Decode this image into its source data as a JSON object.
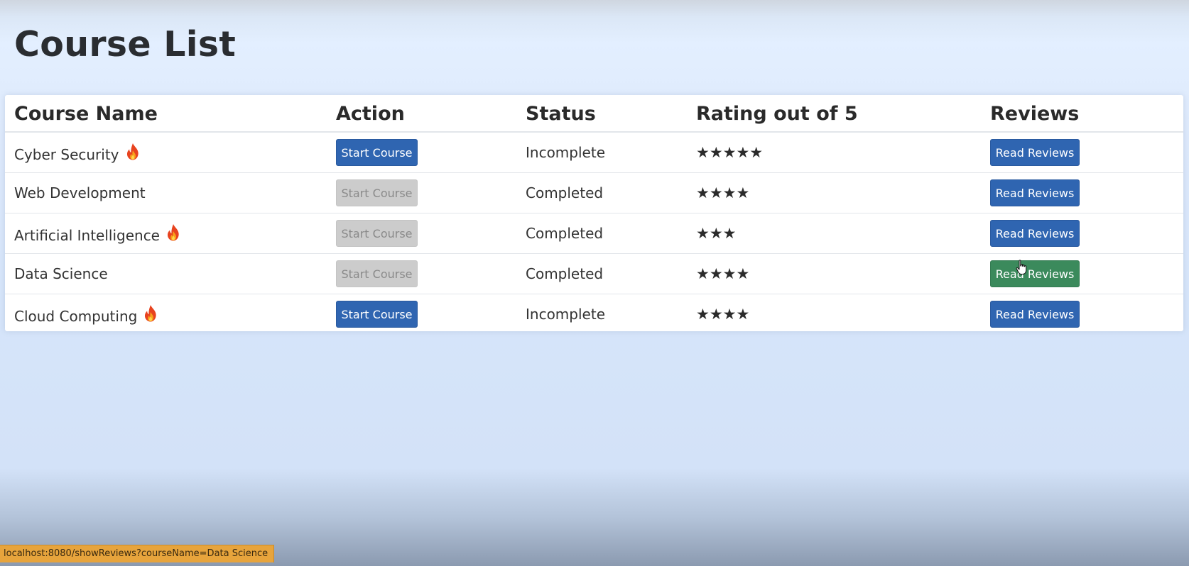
{
  "page": {
    "title": "Course List"
  },
  "table": {
    "headers": {
      "course_name": "Course Name",
      "action": "Action",
      "status": "Status",
      "rating": "Rating out of 5",
      "reviews": "Reviews"
    },
    "rows": [
      {
        "name": "Cyber Security",
        "trending": true,
        "action_label": "Start Course",
        "action_enabled": true,
        "status": "Incomplete",
        "rating_value": 5,
        "rating_stars": "★★★★★",
        "reviews_label": "Read Reviews",
        "reviews_hovered": false
      },
      {
        "name": "Web Development",
        "trending": false,
        "action_label": "Start Course",
        "action_enabled": false,
        "status": "Completed",
        "rating_value": 4,
        "rating_stars": "★★★★",
        "reviews_label": "Read Reviews",
        "reviews_hovered": false
      },
      {
        "name": "Artificial Intelligence",
        "trending": true,
        "action_label": "Start Course",
        "action_enabled": false,
        "status": "Completed",
        "rating_value": 3,
        "rating_stars": "★★★",
        "reviews_label": "Read Reviews",
        "reviews_hovered": false
      },
      {
        "name": "Data Science",
        "trending": false,
        "action_label": "Start Course",
        "action_enabled": false,
        "status": "Completed",
        "rating_value": 4,
        "rating_stars": "★★★★",
        "reviews_label": "Read Reviews",
        "reviews_hovered": true
      },
      {
        "name": "Cloud Computing",
        "trending": true,
        "action_label": "Start Course",
        "action_enabled": true,
        "status": "Incomplete",
        "rating_value": 4,
        "rating_stars": "★★★★",
        "reviews_label": "Read Reviews",
        "reviews_hovered": false
      }
    ]
  },
  "status_bar": {
    "url": "localhost:8080/showReviews?courseName=Data Science"
  },
  "icons": {
    "trending": "flame-icon",
    "cursor": "hand-pointer-icon"
  },
  "colors": {
    "primary_button": "#2f65b1",
    "hover_button": "#3b8a5c",
    "disabled_button": "#cccccc",
    "status_bar": "#e7a43c"
  }
}
